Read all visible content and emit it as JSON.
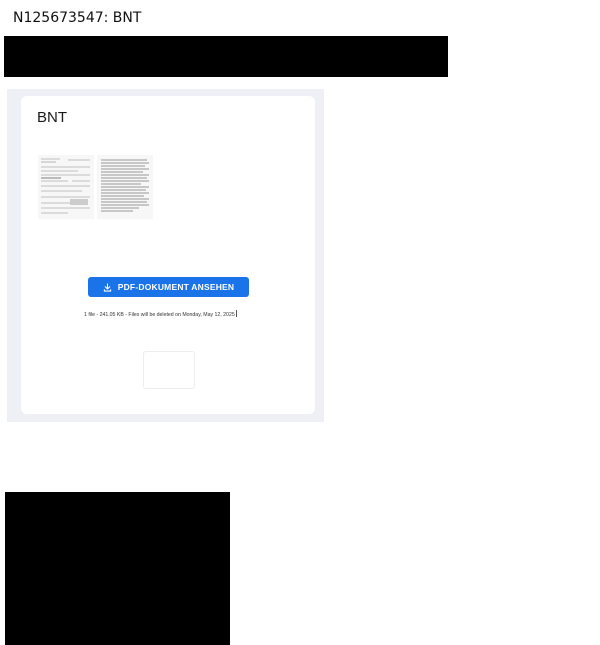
{
  "header": {
    "subject": "N125673547: BNT"
  },
  "card": {
    "title": "BNT",
    "thumbnails": [
      {
        "icon": "document-page-thumbnail"
      },
      {
        "icon": "document-page-thumbnail"
      }
    ],
    "button_icon": "download-icon",
    "button_label": "PDF-DOKUMENT ANSEHEN",
    "file_info": "1 file - 241.05 KB - Files will be deleted on Monday, May 12, 2025"
  },
  "colors": {
    "button_blue": "#1a73e8",
    "panel_bg": "#eef0f6",
    "redaction": "#000000"
  }
}
